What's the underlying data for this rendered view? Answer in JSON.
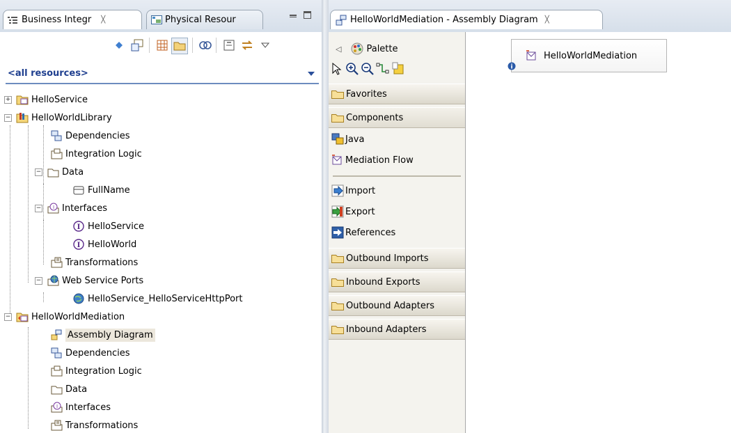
{
  "left_view": {
    "tabs": [
      {
        "label": "Business Integr",
        "close": "╳",
        "icon": "business-integration-icon"
      },
      {
        "label": "Physical Resour",
        "icon": "physical-resources-icon"
      }
    ],
    "filter": {
      "label": "<all resources>"
    },
    "tree": [
      {
        "label": "HelloService",
        "icon": "module-icon",
        "level": 0,
        "expander": "+"
      },
      {
        "label": "HelloWorldLibrary",
        "icon": "library-icon",
        "level": 0,
        "expander": "−"
      },
      {
        "label": "Dependencies",
        "icon": "dependencies-icon",
        "level": 1
      },
      {
        "label": "Integration Logic",
        "icon": "integration-logic-icon",
        "level": 1
      },
      {
        "label": "Data",
        "icon": "data-icon",
        "level": 1,
        "expander": "−"
      },
      {
        "label": "FullName",
        "icon": "business-object-icon",
        "level": 2
      },
      {
        "label": "Interfaces",
        "icon": "interfaces-icon",
        "level": 1,
        "expander": "−"
      },
      {
        "label": "HelloService",
        "icon": "interface-icon",
        "level": 2
      },
      {
        "label": "HelloWorld",
        "icon": "interface-icon",
        "level": 2
      },
      {
        "label": "Transformations",
        "icon": "transformations-icon",
        "level": 1
      },
      {
        "label": "Web Service Ports",
        "icon": "web-service-ports-icon",
        "level": 1,
        "expander": "−"
      },
      {
        "label": "HelloService_HelloServiceHttpPort",
        "icon": "web-service-port-icon",
        "level": 2
      },
      {
        "label": "HelloWorldMediation",
        "icon": "mediation-module-icon",
        "level": 0,
        "expander": "−"
      },
      {
        "label": "Assembly Diagram",
        "icon": "assembly-diagram-icon",
        "level": 1,
        "selected": true
      },
      {
        "label": "Dependencies",
        "icon": "dependencies-icon",
        "level": 1
      },
      {
        "label": "Integration Logic",
        "icon": "integration-logic-icon",
        "level": 1
      },
      {
        "label": "Data",
        "icon": "data-icon",
        "level": 1
      },
      {
        "label": "Interfaces",
        "icon": "interfaces-icon",
        "level": 1
      },
      {
        "label": "Transformations",
        "icon": "transformations-icon",
        "level": 1
      }
    ]
  },
  "editor": {
    "tab": {
      "label": "HelloWorldMediation - Assembly Diagram",
      "close": "╳"
    },
    "palette": {
      "title": "Palette",
      "collapse_glyph": "◁",
      "tools": [
        "select-arrow-icon",
        "zoom-in-icon",
        "zoom-out-icon",
        "wire-icon",
        "note-icon"
      ],
      "drawers": [
        {
          "label": "Favorites"
        },
        {
          "label": "Components",
          "open": true,
          "items": [
            {
              "label": "Java",
              "icon": "java-component-icon"
            },
            {
              "label": "Mediation Flow",
              "icon": "mediation-flow-icon"
            },
            {
              "label": "Import",
              "icon": "import-icon"
            },
            {
              "label": "Export",
              "icon": "export-icon"
            },
            {
              "label": "References",
              "icon": "references-icon"
            }
          ]
        },
        {
          "label": "Outbound Imports"
        },
        {
          "label": "Inbound Exports"
        },
        {
          "label": "Outbound Adapters"
        },
        {
          "label": "Inbound Adapters"
        }
      ]
    },
    "canvas": {
      "nodes": [
        {
          "label": "HelloWorldMediation",
          "icon": "mediation-flow-icon",
          "badge": "info-marker-icon"
        }
      ]
    }
  },
  "colors": {
    "link": "#1f3f8f",
    "tab_bg": "#dde4ed",
    "palette_bg": "#f4f3ee",
    "drawer_bg": "#dcd8cc",
    "selection": "#ece7dc"
  }
}
